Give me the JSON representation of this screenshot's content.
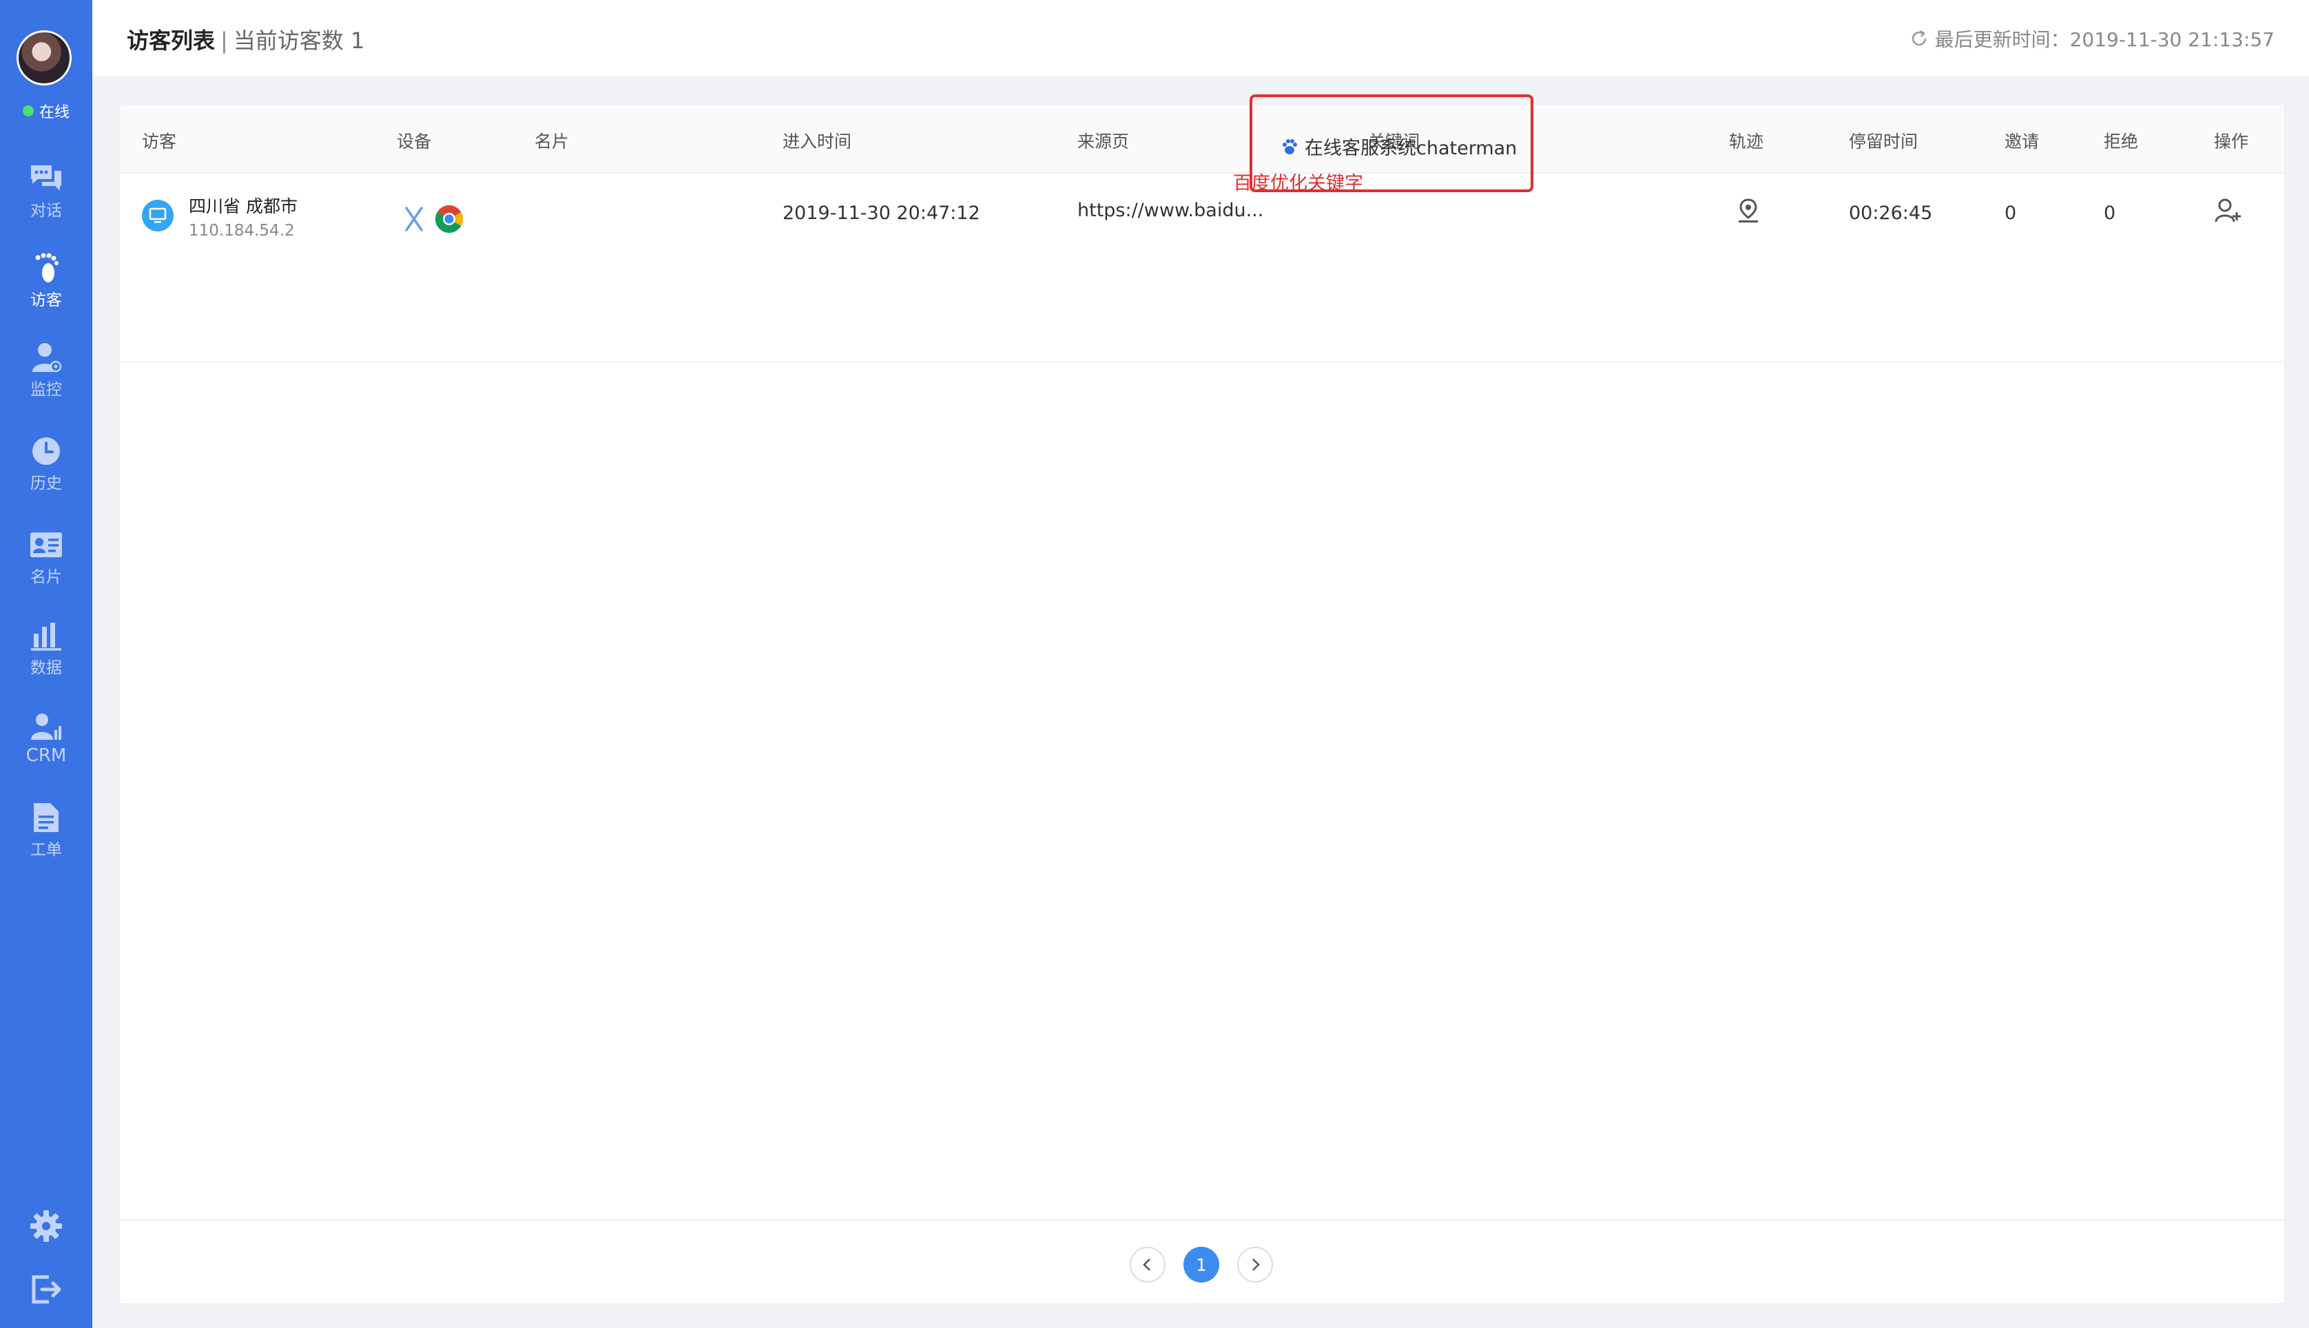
{
  "sidebar": {
    "status": "在线",
    "items": [
      {
        "label": "对话",
        "icon": "chat-icon",
        "active": false
      },
      {
        "label": "访客",
        "icon": "footprint-icon",
        "active": true
      },
      {
        "label": "监控",
        "icon": "monitor-user-icon",
        "active": false
      },
      {
        "label": "历史",
        "icon": "clock-icon",
        "active": false
      },
      {
        "label": "名片",
        "icon": "card-icon",
        "active": false
      },
      {
        "label": "数据",
        "icon": "bar-chart-icon",
        "active": false
      },
      {
        "label": "CRM",
        "icon": "crm-icon",
        "active": false
      },
      {
        "label": "工单",
        "icon": "document-icon",
        "active": false
      }
    ],
    "bottom_icons": [
      "gear-icon",
      "logout-icon"
    ]
  },
  "header": {
    "title": "访客列表",
    "separator": "|",
    "subtitle": "当前访客数 1",
    "update_text": "最后更新时间：2019-11-30 21:13:57"
  },
  "table": {
    "columns": [
      "访客",
      "设备",
      "名片",
      "进入时间",
      "来源页",
      "关键词",
      "轨迹",
      "停留时间",
      "邀请",
      "拒绝",
      "操作"
    ],
    "rows": [
      {
        "location": "四川省 成都市",
        "ip": "110.184.54.2",
        "card": "",
        "enter_time": "2019-11-30 20:47:12",
        "source": "https://www.baidu...",
        "keyword": "在线客服系统chaterman",
        "stay_time": "00:26:45",
        "invite": "0",
        "reject": "0"
      }
    ]
  },
  "annotation": "百度优化关键字",
  "pagination": {
    "current": "1"
  },
  "colors": {
    "sidebar": "#3a73e4",
    "accent": "#3c8bef",
    "highlight": "#e02f2f",
    "online": "#4ce26f"
  }
}
